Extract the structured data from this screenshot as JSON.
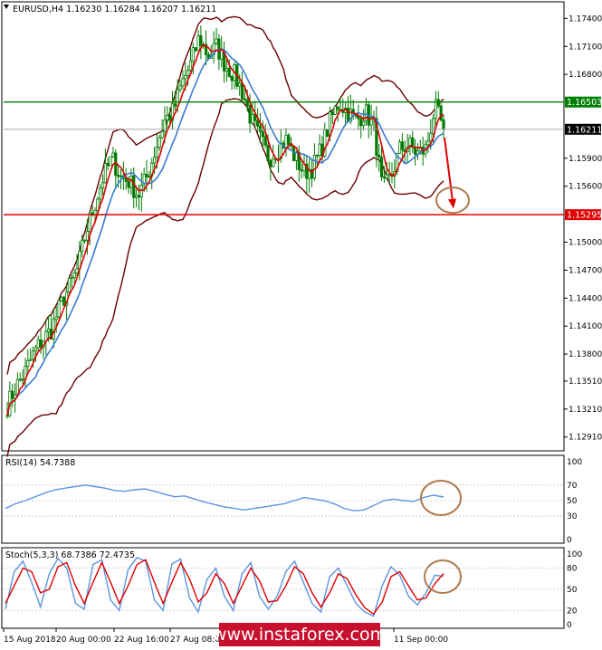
{
  "header": {
    "symbol_line": "EURUSD,H4  1.16230 1.16284 1.16207 1.16211",
    "rsi_line": "RSI(14) 54.7388",
    "stoch_line": "Stoch(5,3,3) 68.7386 72.4735"
  },
  "watermark": "www.instaforex.com",
  "colors": {
    "price_bar": "#007a00",
    "bollinger": "#6b0000",
    "ma_fast": "#e00000",
    "ma_slow": "#3a7bd5",
    "resistance": "#008000",
    "support": "#e00000",
    "rsi_line": "#5c95e0",
    "stoch_main": "#5c95e0",
    "stoch_signal": "#e00000",
    "annotation_circle": "#b07a4a",
    "arrow": "#e00000"
  },
  "chart_data": [
    {
      "type": "candlestick",
      "title": "EURUSD,H4",
      "ohlc_last": {
        "open": "1.16230",
        "high": "1.16284",
        "low": "1.16207",
        "close": "1.16211"
      },
      "y_ticks": [
        "1.17400",
        "1.17100",
        "1.16800",
        "1.16503",
        "1.16211",
        "1.15900",
        "1.15600",
        "1.15295",
        "1.15000",
        "1.14700",
        "1.14400",
        "1.14100",
        "1.13800",
        "1.13510",
        "1.13210",
        "1.12910"
      ],
      "ylim": [
        1.1282,
        1.1752
      ],
      "x_labels": [
        "15 Aug 2018",
        "20 Aug 00:00",
        "22 Aug 16:00",
        "27 Aug 08:00",
        "11 Sep 00:00"
      ],
      "levels": [
        {
          "label": "1.16503",
          "value": 1.16503,
          "color": "#008000"
        },
        {
          "label": "1.15295",
          "value": 1.15295,
          "color": "#e00000"
        }
      ],
      "current_price": {
        "label": "1.16211",
        "value": 1.16211
      },
      "close_path": [
        1.1325,
        1.1345,
        1.136,
        1.138,
        1.1395,
        1.1405,
        1.143,
        1.145,
        1.147,
        1.151,
        1.154,
        1.157,
        1.159,
        1.157,
        1.1565,
        1.155,
        1.157,
        1.16,
        1.163,
        1.164,
        1.167,
        1.169,
        1.172,
        1.17,
        1.171,
        1.169,
        1.168,
        1.166,
        1.163,
        1.161,
        1.159,
        1.16,
        1.161,
        1.159,
        1.1575,
        1.158,
        1.16,
        1.163,
        1.165,
        1.164,
        1.163,
        1.164,
        1.1625,
        1.1555,
        1.157,
        1.16,
        1.1605,
        1.1595,
        1.16,
        1.1645,
        1.1621
      ],
      "annotation": "bearish arrow toward support at 1.15295"
    },
    {
      "type": "line",
      "title": "RSI(14) 54.7388",
      "y_ticks": [
        "100",
        "70",
        "50",
        "30",
        "0"
      ],
      "ylim": [
        0,
        100
      ],
      "values": [
        40,
        46,
        50,
        55,
        60,
        64,
        66,
        68,
        70,
        68,
        66,
        63,
        62,
        64,
        65,
        62,
        58,
        55,
        56,
        52,
        48,
        45,
        42,
        40,
        38,
        40,
        42,
        44,
        46,
        50,
        54,
        52,
        50,
        46,
        40,
        37,
        38,
        44,
        50,
        52,
        50,
        49,
        54,
        57,
        54.7
      ]
    },
    {
      "type": "line",
      "title": "Stoch(5,3,3) 68.7386 72.4735",
      "y_ticks": [
        "100",
        "80",
        "50",
        "20",
        "0"
      ],
      "ylim": [
        0,
        100
      ],
      "series": [
        {
          "name": "Main",
          "values": [
            22,
            75,
            90,
            60,
            25,
            72,
            94,
            80,
            30,
            22,
            85,
            92,
            35,
            20,
            78,
            95,
            90,
            35,
            20,
            86,
            93,
            38,
            18,
            64,
            80,
            40,
            20,
            72,
            88,
            40,
            22,
            40,
            75,
            90,
            60,
            30,
            18,
            68,
            80,
            55,
            30,
            18,
            12,
            55,
            82,
            70,
            40,
            28,
            45,
            70,
            68.7
          ]
        },
        {
          "name": "Signal",
          "values": [
            30,
            55,
            80,
            75,
            45,
            50,
            82,
            88,
            55,
            30,
            60,
            88,
            60,
            30,
            55,
            85,
            92,
            60,
            30,
            60,
            88,
            65,
            32,
            45,
            72,
            58,
            30,
            55,
            80,
            62,
            32,
            34,
            55,
            82,
            72,
            45,
            25,
            45,
            72,
            65,
            42,
            24,
            15,
            32,
            68,
            75,
            55,
            35,
            38,
            58,
            72.5
          ]
        }
      ]
    }
  ]
}
